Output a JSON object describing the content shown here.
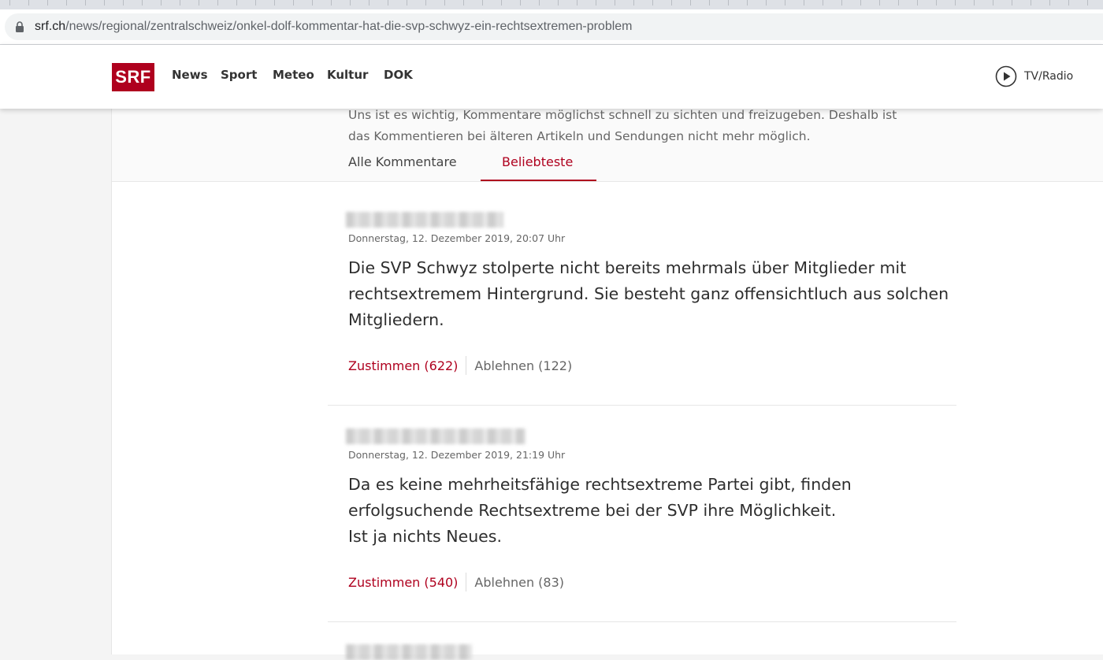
{
  "browser": {
    "url_host": "srf.ch",
    "url_path": "/news/regional/zentralschweiz/onkel-dolf-kommentar-hat-die-svp-schwyz-ein-rechtsextremen-problem"
  },
  "header": {
    "logo": "SRF",
    "nav": [
      "News",
      "Sport",
      "Meteo",
      "Kultur",
      "DOK"
    ],
    "tvradio_label": "TV/Radio"
  },
  "comments_section": {
    "notice_lines": [
      "Uns ist es wichtig, Kommentare möglichst schnell zu sichten und freizugeben. Deshalb ist",
      "das Kommentieren bei älteren Artikeln und Sendungen nicht mehr möglich."
    ],
    "tabs": [
      "Alle Kommentare",
      "Beliebteste"
    ],
    "active_tab": "Beliebteste"
  },
  "comments": [
    {
      "date": "Donnerstag, 12. Dezember 2019, 20:07 Uhr",
      "lines": [
        "Die SVP Schwyz stolperte nicht bereits mehrmals über Mitglieder mit",
        "rechtsextremem Hintergrund. Sie besteht ganz offensichtluch aus solchen",
        "Mitgliedern."
      ],
      "agree": "Zustimmen (622)",
      "disagree": "Ablehnen (122)"
    },
    {
      "date": "Donnerstag, 12. Dezember 2019, 21:19 Uhr",
      "lines": [
        "Da es keine mehrheitsfähige rechtsextreme Partei gibt, finden",
        "erfolgsuchende Rechtsextreme bei der SVP ihre Möglichkeit.",
        "Ist ja nichts Neues."
      ],
      "agree": "Zustimmen (540)",
      "disagree": "Ablehnen (83)"
    }
  ],
  "colors": {
    "brand": "#af001e",
    "text": "#2e2e2e",
    "muted": "#666666"
  }
}
